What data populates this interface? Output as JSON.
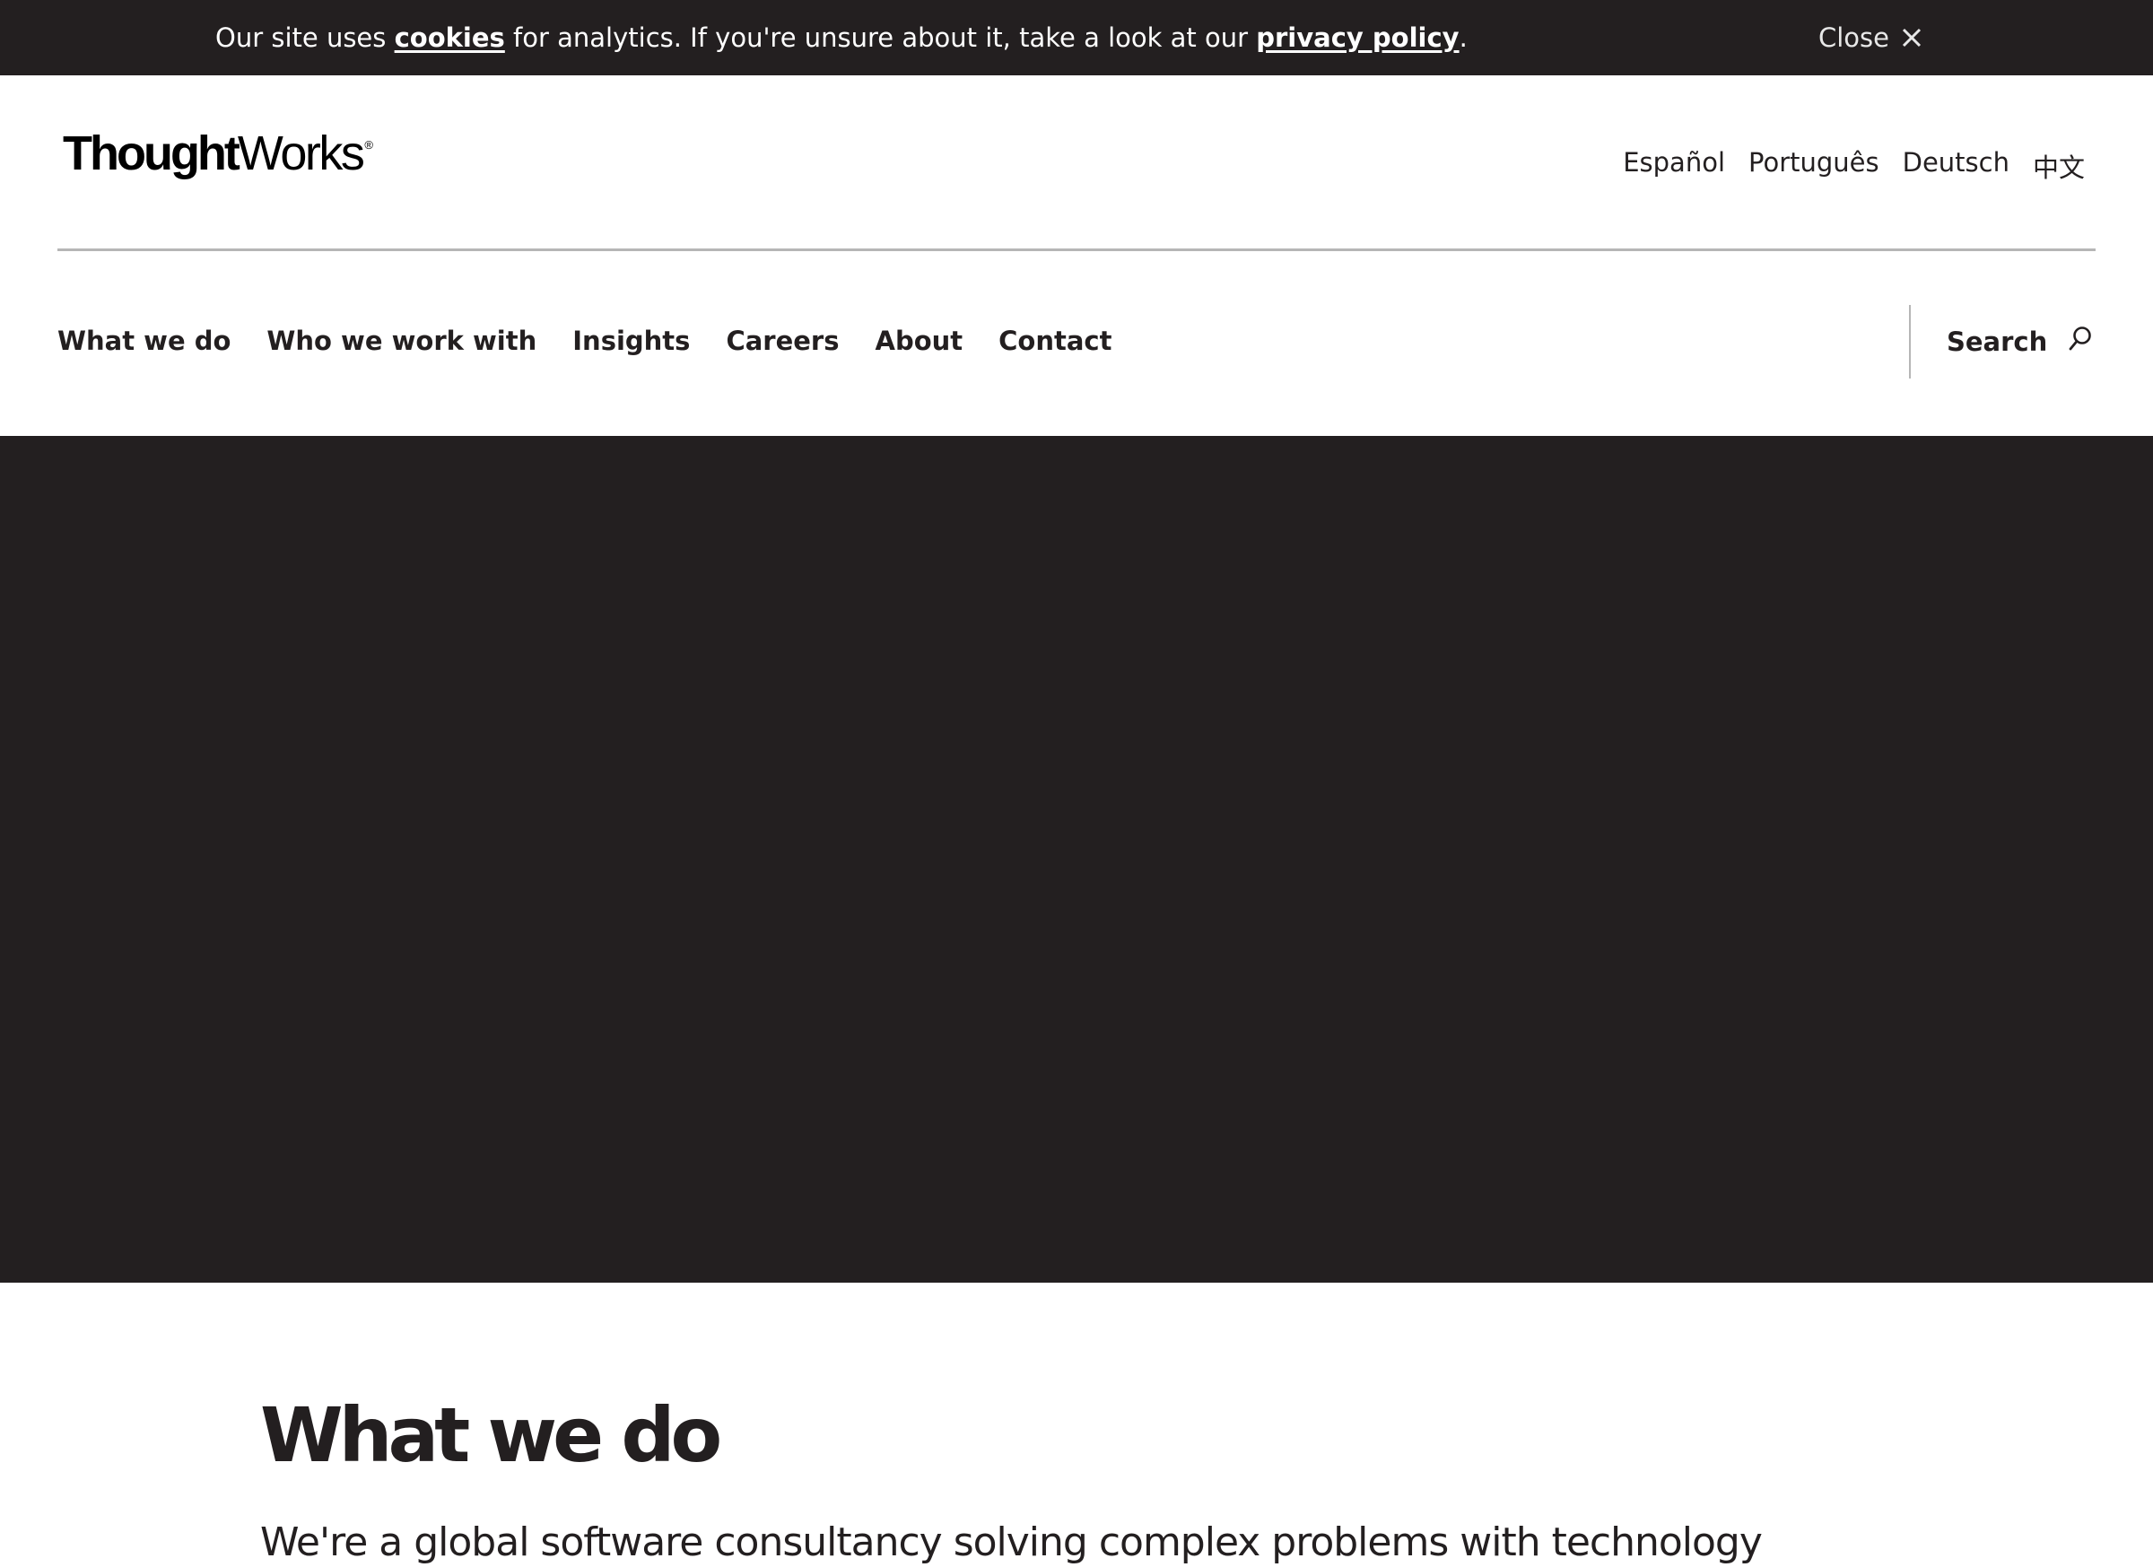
{
  "cookie_banner": {
    "text_before": "Our site uses ",
    "cookies_link": "cookies",
    "text_middle": " for analytics. If you're unsure about it, take a look at our ",
    "privacy_link": "privacy policy",
    "text_after": ".",
    "close_label": "Close",
    "close_icon": "close-icon"
  },
  "header": {
    "logo": {
      "bold_part": "Thought",
      "light_part": "Works",
      "mark": "®"
    },
    "languages": [
      "Español",
      "Português",
      "Deutsch",
      "中文"
    ]
  },
  "nav": {
    "items": [
      "What we do",
      "Who we work with",
      "Insights",
      "Careers",
      "About",
      "Contact"
    ],
    "search_label": "Search",
    "search_icon": "search-icon"
  },
  "hero": {
    "background_color": "#231f20"
  },
  "content": {
    "title": "What we do",
    "lead": "We're a global software consultancy solving complex problems with technology"
  },
  "colors": {
    "dark": "#231f20",
    "divider": "#b6b6b6",
    "background": "#ffffff"
  }
}
